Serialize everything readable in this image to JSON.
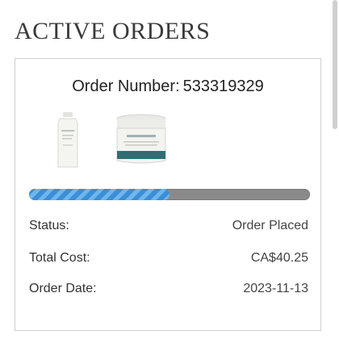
{
  "page": {
    "title": "ACTIVE ORDERS"
  },
  "order": {
    "number_label": "Order Number:",
    "number": "533319329",
    "progress_fraction": 0.5,
    "colors": {
      "progress_fill": "#3a8fd6",
      "progress_track": "#8a8a8a"
    },
    "details": [
      {
        "key": "Status:",
        "value": "Order Placed"
      },
      {
        "key": "Total Cost:",
        "value": "CA$40.25"
      },
      {
        "key": "Order Date:",
        "value": "2023-11-13"
      }
    ]
  }
}
